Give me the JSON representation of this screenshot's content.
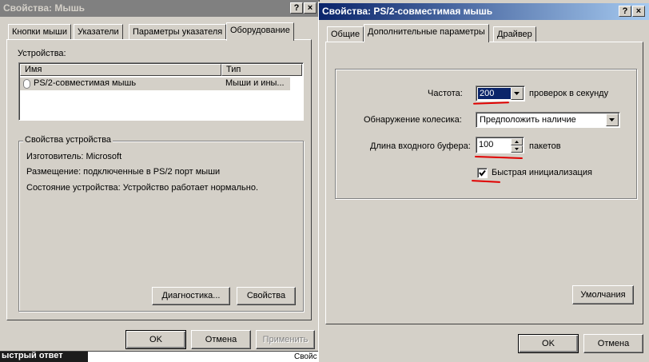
{
  "left_window": {
    "title": "Свойства: Мышь",
    "help_glyph": "?",
    "close_glyph": "×",
    "tabs": [
      "Кнопки мыши",
      "Указатели",
      "Параметры указателя",
      "Оборудование"
    ],
    "devices_label": "Устройства:",
    "columns": [
      "Имя",
      "Тип"
    ],
    "device": {
      "name": "PS/2-совместимая мышь",
      "type": "Мыши и ины..."
    },
    "props_group": "Свойства устройства",
    "manufacturer": "Изготовитель: Microsoft",
    "location": "Размещение: подключенные в PS/2 порт мыши",
    "status": "Состояние устройства: Устройство работает нормально.",
    "diag_button": "Диагностика...",
    "props_button": "Свойства",
    "ok": "OK",
    "cancel": "Отмена",
    "apply": "Применить"
  },
  "right_window": {
    "title": "Свойства: PS/2-совместимая мышь",
    "help_glyph": "?",
    "close_glyph": "×",
    "tabs": [
      "Общие",
      "Дополнительные параметры",
      "Драйвер"
    ],
    "rate_label": "Частота:",
    "rate_value": "200",
    "rate_unit": "проверок в секунду",
    "wheel_label": "Обнаружение колесика:",
    "wheel_value": "Предположить наличие",
    "buffer_label": "Длина входного буфера:",
    "buffer_value": "100",
    "buffer_unit": "пакетов",
    "fast_init_label": "Быстрая инициализация",
    "fast_init_checked": true,
    "defaults_button": "Умолчания",
    "ok": "OK",
    "cancel": "Отмена"
  },
  "background": {
    "taskbar_text": "ыстрый ответ",
    "behind_text": "Свойс"
  },
  "colors": {
    "annotation_red": "#e00000",
    "selection_blue": "#0a246a",
    "active_title": "#0a246a"
  }
}
